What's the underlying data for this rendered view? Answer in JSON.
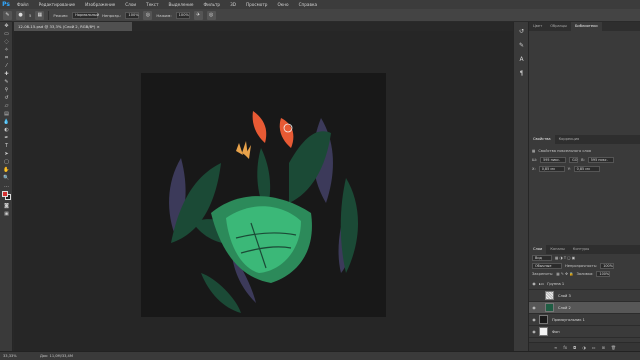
{
  "app": {
    "logo": "Ps"
  },
  "menu": [
    "Файл",
    "Редактирование",
    "Изображение",
    "Слои",
    "Текст",
    "Выделение",
    "Фильтр",
    "3D",
    "Просмотр",
    "Окно",
    "Справка"
  ],
  "options": {
    "brush_size": "5",
    "mode_label": "Режим:",
    "mode_value": "Нормальный",
    "opacity_label": "Непрозр.:",
    "opacity_value": "100%",
    "flow_label": "Нажим:",
    "flow_value": "100%"
  },
  "document": {
    "tab": "12-08-15.psd @ 33,3% (Слой 2, RGB/8*) ×",
    "canvas_bg": "#181818"
  },
  "status": {
    "zoom": "33,33%",
    "doc_size": "Док: 11,0M/33,4M"
  },
  "panels": {
    "top_tabs": [
      "Цвет",
      "Образцы",
      "Библиотеки"
    ],
    "properties_tabs": [
      "Свойства",
      "Коррекция"
    ],
    "properties_title": "Свойства пиксельного слоя",
    "W_label": "Ш:",
    "W_value": "595 пикс.",
    "GO_label": "GO",
    "H_label": "В:",
    "H_value": "595 пикс.",
    "X_label": "X:",
    "X_value": "0,85 см",
    "Y_label": "Y:",
    "Y_value": "0,85 см",
    "layers_tabs": [
      "Слои",
      "Каналы",
      "Контуры"
    ],
    "kind_label": "Вид",
    "blend_value": "Обычные",
    "opacity_label": "Непрозрачность:",
    "opacity_value": "100%",
    "lock_label": "Закрепить:",
    "fill_label": "Заливка:",
    "fill_value": "100%",
    "layers": [
      {
        "name": "Группа 1",
        "type": "group"
      },
      {
        "name": "Слой 3",
        "type": "layer"
      },
      {
        "name": "Слой 2",
        "type": "layer",
        "selected": true
      },
      {
        "name": "Прямоугольник 1",
        "type": "shape"
      },
      {
        "name": "Фон",
        "type": "background"
      }
    ]
  },
  "artwork": {
    "colors": {
      "dark_leaf": "#1b4a36",
      "light_leaf": "#2c8a5a",
      "bright_leaf": "#3bb878",
      "purple_leaf": "#3c3a5a",
      "orange_flower": "#e85a34",
      "yellow_flower": "#e8a24a",
      "brush_cursor": "#f2f2f2"
    }
  }
}
